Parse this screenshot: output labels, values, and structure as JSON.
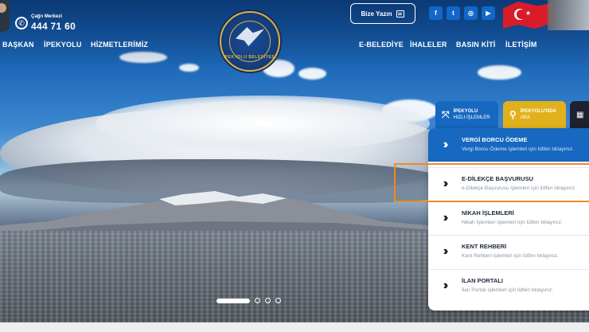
{
  "header": {
    "call_center_label": "Çağrı Merkezi",
    "call_center_number": "444 71 60",
    "write_button": "Bize Yazın",
    "logo_text": "İPEKYOLU BELEDİYESİ",
    "social": [
      {
        "icon": "facebook-icon",
        "glyph": "f"
      },
      {
        "icon": "twitter-icon",
        "glyph": "t"
      },
      {
        "icon": "instagram-icon",
        "glyph": "◎"
      },
      {
        "icon": "youtube-icon",
        "glyph": "▶"
      }
    ]
  },
  "nav": {
    "left": [
      "BAŞKAN",
      "İPEKYOLU",
      "HİZMETLERİMİZ"
    ],
    "right": [
      "E-BELEDİYE",
      "İHALELER",
      "BASIN KİTİ",
      "İLETİŞİM"
    ]
  },
  "quick_tabs": [
    {
      "title": "İPEKYOLU",
      "subtitle": "HIZLI İŞLEMLER",
      "color": "#1668c0"
    },
    {
      "title": "İPEKYOLU'NDA",
      "subtitle": "ARA",
      "color": "#e1b11c"
    },
    {
      "title": "",
      "subtitle": "",
      "color": "#1c2230"
    }
  ],
  "quick_links": [
    {
      "title": "VERGİ BORCU ÖDEME",
      "desc": "Vergi Borcu Ödeme işlemleri için lütfen tıklayınız."
    },
    {
      "title": "E-DİLEKÇE BAŞVURUSU",
      "desc": "e-Dilekçe Başvurusu işlemleri için lütfen tıklayınız."
    },
    {
      "title": "NİKAH İŞLEMLERİ",
      "desc": "Nikah İşlemleri işlemleri için lütfen tıklayınız."
    },
    {
      "title": "KENT REHBERİ",
      "desc": "Kent Rehberi işlemleri için lütfen tıklayınız."
    },
    {
      "title": "İLAN PORTALI",
      "desc": "İlan Portalı işlemleri için lütfen tıklayınız."
    }
  ],
  "slider": {
    "count": 4,
    "active": 1
  },
  "colors": {
    "primary": "#1668c0",
    "accent": "#e1b11c",
    "highlight": "#f08a24"
  }
}
